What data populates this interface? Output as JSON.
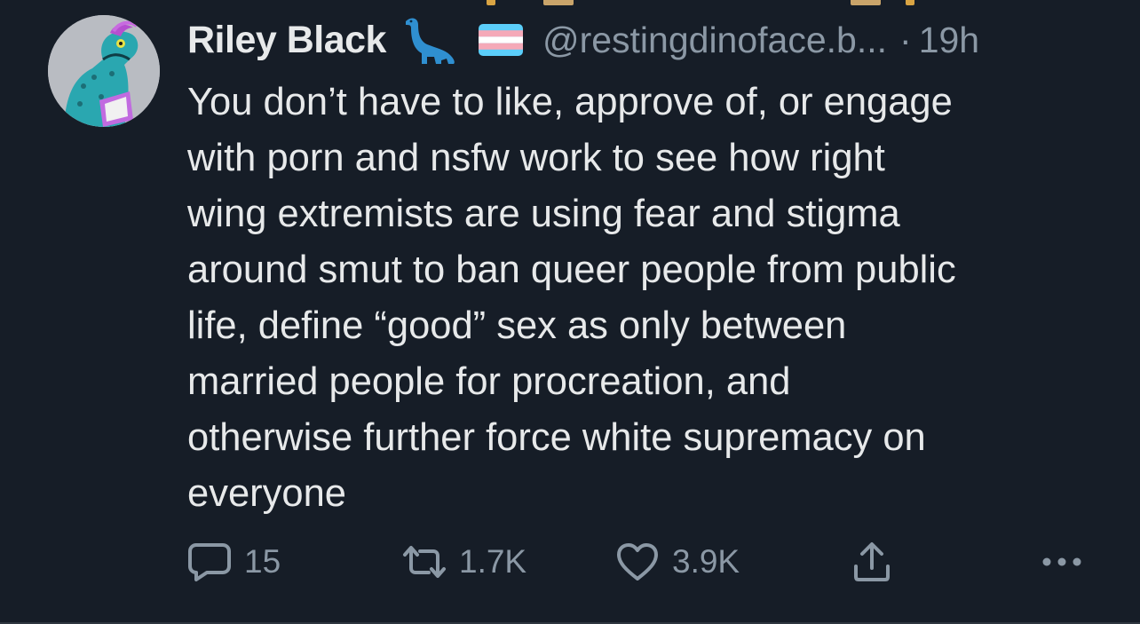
{
  "tweet": {
    "author": {
      "display_name": "Riley Black",
      "handle": "@restingdinoface.b...",
      "name_emoji": [
        "sauropod-icon",
        "transgender-flag-icon"
      ],
      "avatar": "dinosaur-avatar"
    },
    "separator": "·",
    "timestamp": "19h",
    "text": "You don’t have to like, approve of, or engage\nwith porn and nsfw work to see how right\nwing extremists are using fear and stigma\naround smut to ban queer people from public\nlife, define “good” sex as only between\nmarried people for procreation, and\notherwise further force white supremacy on\neveryone",
    "actions": {
      "reply": {
        "icon": "reply-icon",
        "count": "15"
      },
      "retweet": {
        "icon": "retweet-icon",
        "count": "1.7K"
      },
      "like": {
        "icon": "heart-icon",
        "count": "3.9K"
      },
      "share": {
        "icon": "share-icon"
      },
      "more": {
        "icon": "more-icon"
      }
    }
  },
  "colors": {
    "background": "#161d27",
    "text_primary": "#e7e9ea",
    "text_secondary": "#8b98a5"
  }
}
